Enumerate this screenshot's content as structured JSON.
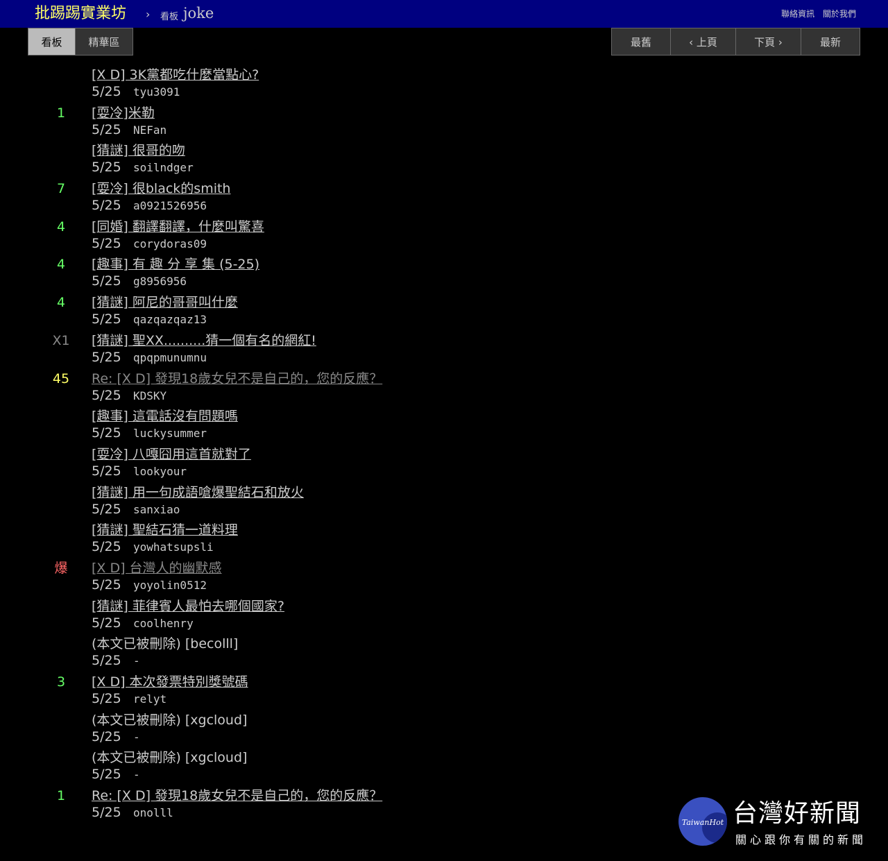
{
  "header": {
    "site_title": "批踢踢實業坊",
    "crumb_sep": "›",
    "crumb_label": "看板",
    "board_name": "joke",
    "links": [
      "聯絡資訊",
      "關於我們"
    ]
  },
  "tabs": [
    "看板",
    "精華區"
  ],
  "pager": [
    "最舊",
    "‹ 上頁",
    "下頁 ›",
    "最新"
  ],
  "colors": {
    "nrec_green": "#66ff66",
    "nrec_yellow": "#ffff66",
    "nrec_red": "#ff6666",
    "nrec_gray": "#888888",
    "header_bg": "#000080",
    "site_title": "#ffff66"
  },
  "posts": [
    {
      "nrec": "",
      "title": "[X D] 3K黨都吃什麼當點心?",
      "date": "5/25",
      "author": "tyu3091"
    },
    {
      "nrec": "1",
      "title": "[耍冷]米勒",
      "date": "5/25",
      "author": "NEFan"
    },
    {
      "nrec": "",
      "title": "[猜謎] 很哥的吻",
      "date": "5/25",
      "author": "soilndger"
    },
    {
      "nrec": "7",
      "title": "[耍冷] 很black的smith",
      "date": "5/25",
      "author": "a0921526956"
    },
    {
      "nrec": "4",
      "title": "[同婚] 翻譯翻譯，什麼叫驚喜",
      "date": "5/25",
      "author": "corydoras09"
    },
    {
      "nrec": "4",
      "title": "[趣事] 有 趣 分 享 集 (5-25)",
      "date": "5/25",
      "author": "g8956956"
    },
    {
      "nrec": "4",
      "title": "[猜謎] 阿尼的哥哥叫什麼",
      "date": "5/25",
      "author": "qazqazqaz13"
    },
    {
      "nrec": "X1",
      "title": "[猜謎] 聖XX..........猜一個有名的網紅!",
      "date": "5/25",
      "author": "qpqpmunumnu"
    },
    {
      "nrec": "45",
      "title": "Re: [X D] 發現18歲女兒不是自己的，您的反應？",
      "date": "5/25",
      "author": "KDSKY"
    },
    {
      "nrec": "",
      "title": "[趣事] 這電話沒有問題嗎",
      "date": "5/25",
      "author": "luckysummer"
    },
    {
      "nrec": "",
      "title": "[耍冷] 八嘎囧用這首就對了",
      "date": "5/25",
      "author": "lookyour"
    },
    {
      "nrec": "",
      "title": "[猜謎] 用一句成語嗆爆聖結石和放火",
      "date": "5/25",
      "author": "sanxiao"
    },
    {
      "nrec": "",
      "title": "[猜謎] 聖結石猜一道料理",
      "date": "5/25",
      "author": "yowhatsupsli"
    },
    {
      "nrec": "爆",
      "title": "[X D] 台灣人的幽默感",
      "date": "5/25",
      "author": "yoyolin0512"
    },
    {
      "nrec": "",
      "title": "[猜謎] 菲律賓人最怕去哪個國家?",
      "date": "5/25",
      "author": "coolhenry"
    },
    {
      "nrec": "",
      "title": "(本文已被刪除) [becolll]",
      "date": "5/25",
      "author": "-"
    },
    {
      "nrec": "3",
      "title": "[X D] 本次發票特別獎號碼",
      "date": "5/25",
      "author": "relyt"
    },
    {
      "nrec": "",
      "title": "(本文已被刪除) [xgcloud]",
      "date": "5/25",
      "author": "-"
    },
    {
      "nrec": "",
      "title": "(本文已被刪除) [xgcloud]",
      "date": "5/25",
      "author": "-"
    },
    {
      "nrec": "1",
      "title": "Re: [X D] 發現18歲女兒不是自己的，您的反應？",
      "date": "5/25",
      "author": "onolll"
    }
  ],
  "watermark": {
    "latin": "TaiwanHot",
    "name_cn": "台灣好新聞",
    "slogan": "關心跟你有關的新聞"
  }
}
